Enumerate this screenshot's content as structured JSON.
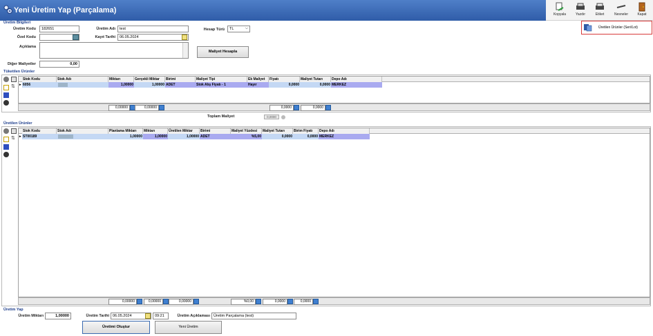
{
  "window": {
    "title": "Yeni Üretim Yap (Parçalama)"
  },
  "toolbar": {
    "kopyala": "Kopyala",
    "yazdir": "Yazdır",
    "etiket": "Etiket",
    "nesneler": "Nesneler",
    "kapat": "Kapat"
  },
  "dropdown": {
    "item": "Üretilen Ürünler (Seri/Lot)"
  },
  "uretim_bilgileri": {
    "section": "Üretim Bilgileri",
    "uretim_kodu_label": "Üretim Kodu",
    "uretim_kodu": "182651",
    "uretim_adi_label": "Üretim Adı",
    "uretim_adi": "test",
    "hesap_turu_label": "Hesap Türü",
    "hesap_turu": "TL",
    "ozel_kodu_label": "Özel Kodu",
    "ozel_kodu": "",
    "kayit_tarihi_label": "Kayıt Tarihi",
    "kayit_tarihi": "06.05.2024",
    "aciklama_label": "Açıklama",
    "aciklama": "",
    "maliyet_hesapla": "Maliyet Hesapla",
    "diger_maliyetler_label": "Diğer Maliyetler",
    "diger_maliyetler": "0,00"
  },
  "tuketilen": {
    "section": "Tüketilen Ürünler",
    "columns": [
      "Stok Kodu",
      "Stok Adı",
      "Miktarı",
      "Gerçekli Miktar",
      "Birimi",
      "Maliyet Tipi",
      "Ek Maliyet",
      "Fiyatı",
      "Maliyet Tutarı",
      "Depo Adı"
    ],
    "rows": [
      {
        "stok_kodu": "6056",
        "stok_adi": "",
        "miktari": "1,00000",
        "gercekli": "1,00000",
        "birimi": "ADET",
        "maliyet_tipi": "Stok Alış Fiyatı - 1",
        "ek_maliyet": "Hayır",
        "fiyati": "0,0000",
        "tutar": "0,0000",
        "depo": "MERKEZ"
      }
    ],
    "totals": {
      "miktar": "0,00000",
      "gercekli": "0,00000",
      "fiyat": "0,0000",
      "tutar": "0,0000"
    }
  },
  "toplam_maliyet": {
    "label": "Toplam Maliyet",
    "value": "0,0000"
  },
  "uretilen": {
    "section": "Üretilen Ürünler",
    "columns": [
      "Stok Kodu",
      "Stok Adı",
      "Planlama Miktarı",
      "Miktarı",
      "Üretilen Miktar",
      "Birimi",
      "Maliyet Yüzdesi",
      "Maliyet Tutarı",
      "Birim Fiyatı",
      "Depo Adı"
    ],
    "rows": [
      {
        "stok_kodu": "ST00189",
        "stok_adi": "",
        "planlama": "1,00000",
        "miktari": "1,00000",
        "uretilen": "1,00000",
        "birimi": "ADET",
        "yuzde": "%5,00",
        "tutar": "0,0000",
        "birim_fiyat": "0,0000",
        "depo": "MERKEZ"
      }
    ],
    "totals": {
      "planlama": "0,00000",
      "miktar": "0,00000",
      "uretilen": "0,00000",
      "yuzde": "%0,00",
      "tutar": "0,0000",
      "birim": "0,0000"
    }
  },
  "uretim_yap": {
    "section": "Üretim Yap",
    "miktar_label": "Üretim Miktarı",
    "miktar": "1,00000",
    "tarih_label": "Üretim Tarihi",
    "tarih": "06.05.2024",
    "saat": "09:21",
    "aciklama_label": "Üretim Açıklaması",
    "aciklama": "Üretim Parçalama (test)",
    "olustur": "Üretimi Oluştur",
    "yeni": "Yeni Üretim"
  }
}
